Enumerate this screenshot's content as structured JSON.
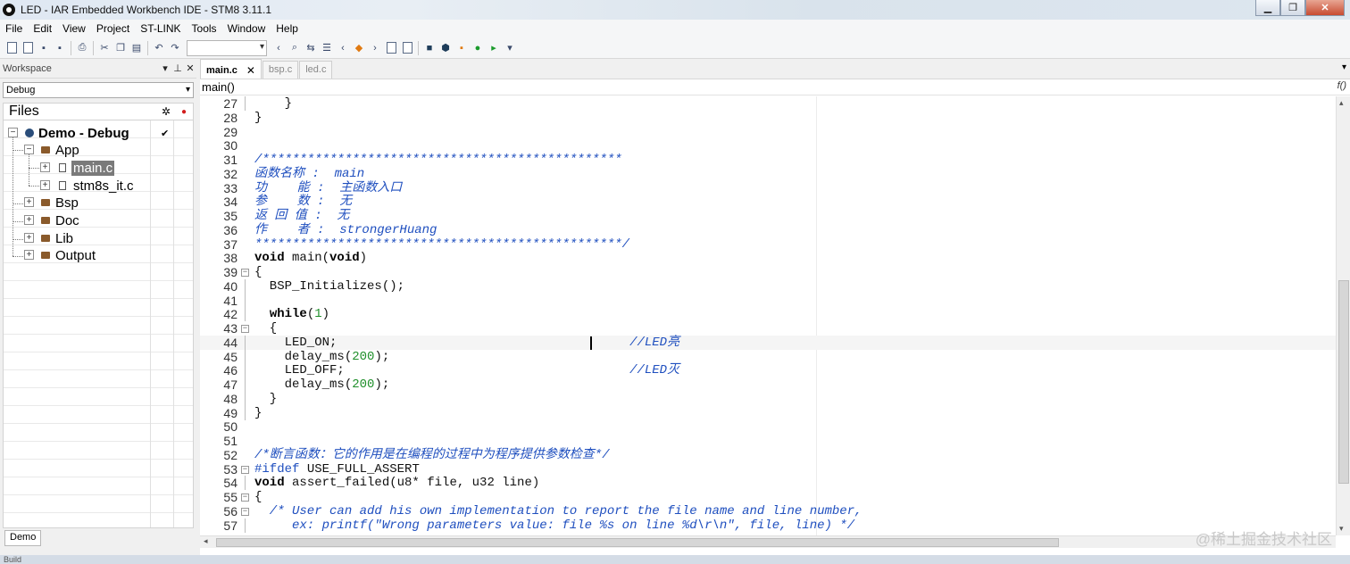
{
  "window": {
    "title": "LED - IAR Embedded Workbench IDE - STM8 3.11.1"
  },
  "menu": [
    "File",
    "Edit",
    "View",
    "Project",
    "ST-LINK",
    "Tools",
    "Window",
    "Help"
  ],
  "workspace": {
    "title": "Workspace",
    "config": "Debug",
    "files_label": "Files",
    "bottom_tab": "Demo",
    "tree": [
      {
        "label": "Demo - Debug",
        "type": "project"
      },
      {
        "label": "App",
        "type": "folder"
      },
      {
        "label": "main.c",
        "type": "file"
      },
      {
        "label": "stm8s_it.c",
        "type": "file"
      },
      {
        "label": "Bsp",
        "type": "folder"
      },
      {
        "label": "Doc",
        "type": "folder"
      },
      {
        "label": "Lib",
        "type": "folder"
      },
      {
        "label": "Output",
        "type": "folder"
      }
    ]
  },
  "editor": {
    "tabs": [
      {
        "label": "main.c",
        "active": true
      },
      {
        "label": "bsp.c",
        "active": false
      },
      {
        "label": "led.c",
        "active": false
      }
    ],
    "function_context": "main()",
    "current_line": 44,
    "lines": [
      {
        "n": "27",
        "text": "    }"
      },
      {
        "n": "28",
        "text": "}"
      },
      {
        "n": "29",
        "text": ""
      },
      {
        "n": "30",
        "text": ""
      },
      {
        "n": "31",
        "text": "/************************************************"
      },
      {
        "n": "32",
        "text": "函数名称 :  main"
      },
      {
        "n": "33",
        "text": "功    能 :  主函数入口"
      },
      {
        "n": "34",
        "text": "参    数 :  无"
      },
      {
        "n": "35",
        "text": "返 回 值 :  无"
      },
      {
        "n": "36",
        "text": "作    者 :  strongerHuang"
      },
      {
        "n": "37",
        "text": "*************************************************/"
      },
      {
        "n": "38",
        "text": "void main(void)"
      },
      {
        "n": "39",
        "text": "{"
      },
      {
        "n": "40",
        "text": "  BSP_Initializes();"
      },
      {
        "n": "41",
        "text": ""
      },
      {
        "n": "42",
        "text": "  while(1)"
      },
      {
        "n": "43",
        "text": "  {"
      },
      {
        "n": "44",
        "text": "    LED_ON;                                       //LED亮"
      },
      {
        "n": "45",
        "text": "    delay_ms(200);"
      },
      {
        "n": "46",
        "text": "    LED_OFF;                                      //LED灭"
      },
      {
        "n": "47",
        "text": "    delay_ms(200);"
      },
      {
        "n": "48",
        "text": "  }"
      },
      {
        "n": "49",
        "text": "}"
      },
      {
        "n": "50",
        "text": ""
      },
      {
        "n": "51",
        "text": ""
      },
      {
        "n": "52",
        "text": "/*断言函数：它的作用是在编程的过程中为程序提供参数检查*/"
      },
      {
        "n": "53",
        "text": "#ifdef USE_FULL_ASSERT"
      },
      {
        "n": "54",
        "text": "void assert_failed(u8* file, u32 line)"
      },
      {
        "n": "55",
        "text": "{"
      },
      {
        "n": "56",
        "text": "  /* User can add his own implementation to report the file name and line number,"
      },
      {
        "n": "57",
        "text": "     ex: printf(\"Wrong parameters value: file %s on line %d\\r\\n\", file, line) */"
      }
    ]
  },
  "statusbar": {
    "text": "Build"
  },
  "watermark": "@稀土掘金技术社区"
}
